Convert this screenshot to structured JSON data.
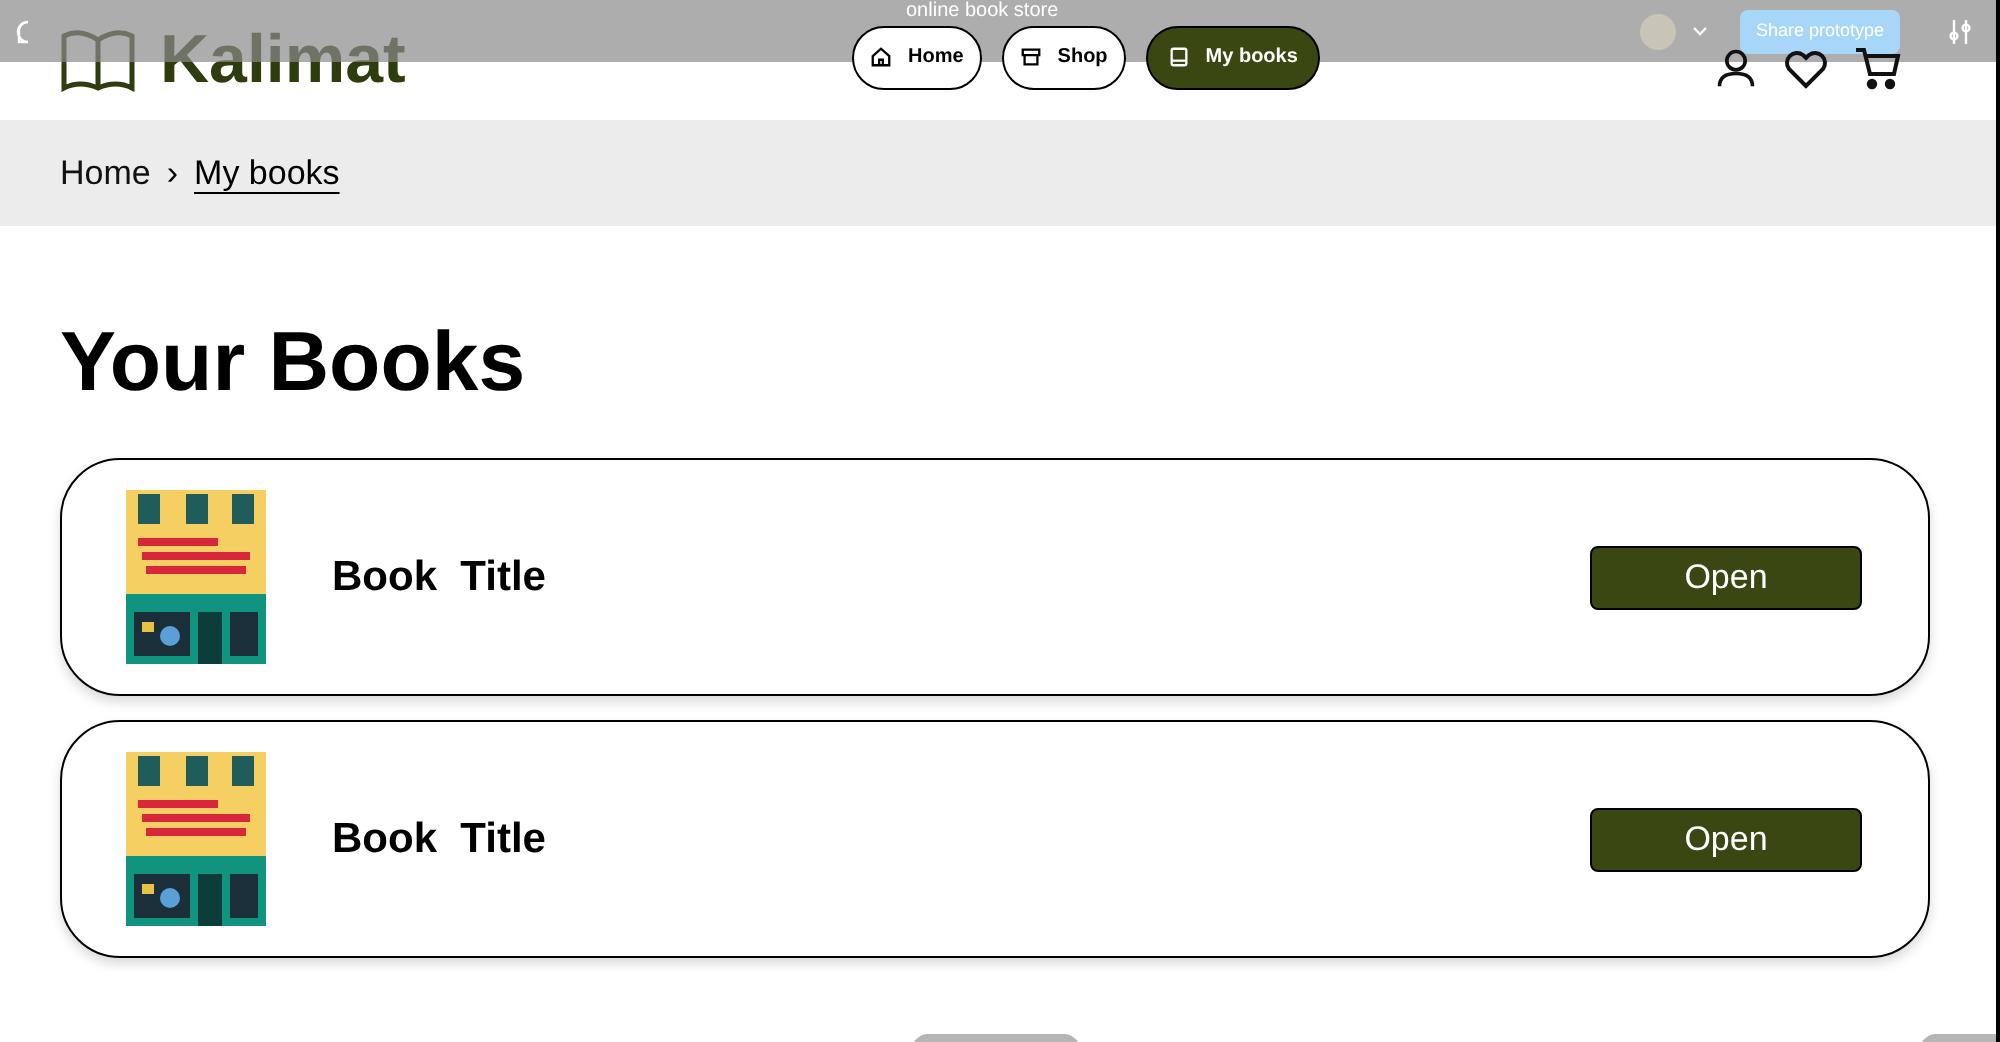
{
  "prototype_bar": {
    "title": "online book store",
    "share_button": "Share prototype"
  },
  "header": {
    "logo": "Kalimat",
    "nav": [
      {
        "label": "Home",
        "kind": "home",
        "selected": false
      },
      {
        "label": "Shop",
        "kind": "shop",
        "selected": false
      },
      {
        "label": "My books",
        "kind": "book",
        "selected": true
      }
    ]
  },
  "breadcrumb": {
    "separator": "›",
    "items": [
      {
        "label": "Home",
        "selected": false
      },
      {
        "label": "My books",
        "selected": true
      }
    ]
  },
  "heading": "Your Books",
  "books": [
    {
      "title": "Book  Title",
      "button": "Open"
    },
    {
      "title": "Book  Title",
      "button": "Open"
    }
  ]
}
